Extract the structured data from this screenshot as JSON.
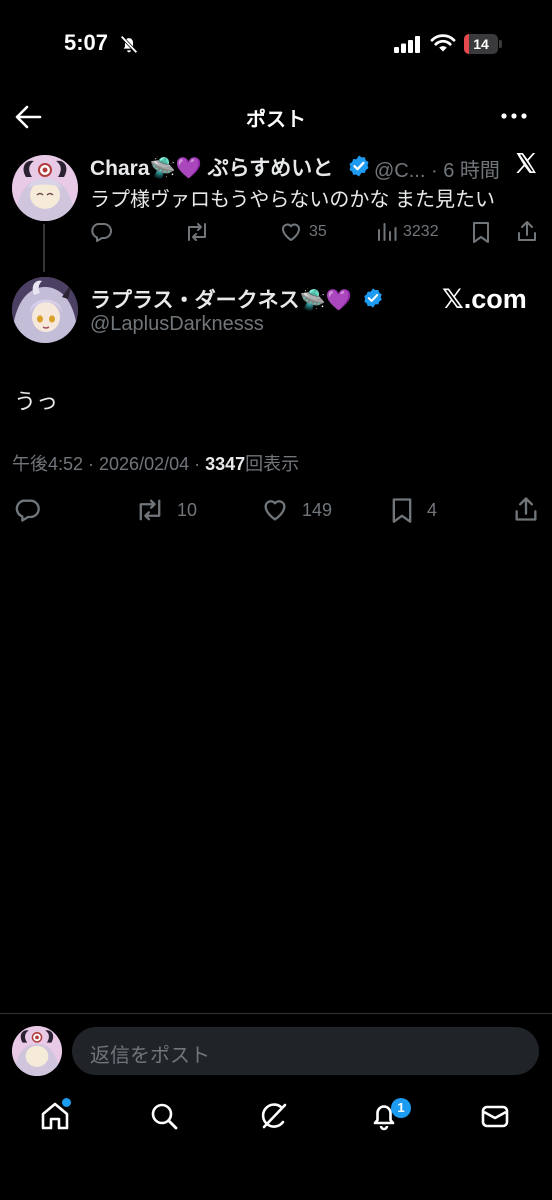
{
  "status_bar": {
    "time": "5:07",
    "battery": "14",
    "battery_level": 0.14
  },
  "header": {
    "title": "ポスト"
  },
  "reply_tweet": {
    "display_name": "Chara🛸💜 ぷらすめいと",
    "handle_time": "@C... · 6 時間",
    "text": "ラプ様ヴァロもうやらないのかな また見たい",
    "likes": "35",
    "views": "3232"
  },
  "main_tweet": {
    "display_name": "ラプラス・ダークネス🛸💜",
    "handle": "@LaplusDarknesss",
    "watermark": "𝕏.com",
    "text": "うっ",
    "time_date": "午後4:52 · 2026/02/04 · ",
    "views_count": "3347",
    "views_label": "回表示",
    "retweets": "10",
    "likes": "149",
    "bookmarks": "4"
  },
  "composer": {
    "placeholder": "返信をポスト"
  },
  "tab_bar": {
    "notification_count": "1"
  },
  "colors": {
    "accent": "#1d9bf0",
    "background": "#000000",
    "muted": "#71767b",
    "text": "#e7e9ea"
  }
}
